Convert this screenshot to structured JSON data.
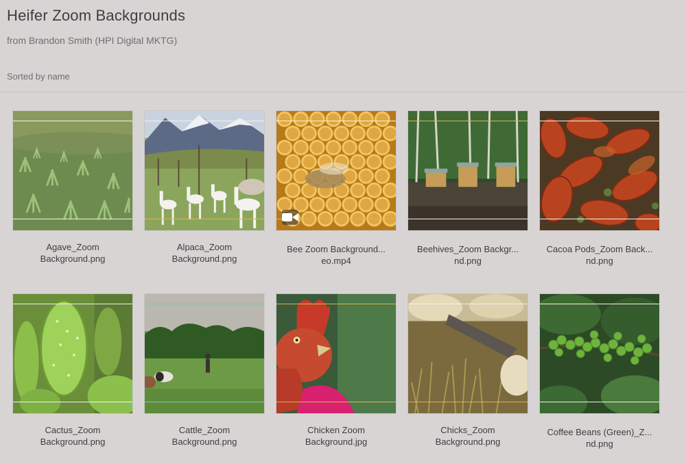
{
  "header": {
    "title": "Heifer Zoom Backgrounds",
    "subtitle": "from Brandon Smith (HPI Digital MKTG)",
    "sort_label": "Sorted by name"
  },
  "files": [
    {
      "line1": "Agave_Zoom",
      "line2": "Background.png",
      "icon": "agave-field-image"
    },
    {
      "line1": "Alpaca_Zoom",
      "line2": "Background.png",
      "icon": "alpaca-image"
    },
    {
      "line1": "Bee Zoom Background...",
      "line2": "eo.mp4",
      "icon": "honeycomb-video"
    },
    {
      "line1": "Beehives_Zoom Backgr...",
      "line2": "nd.png",
      "icon": "beehives-image"
    },
    {
      "line1": "Cacoa Pods_Zoom Back...",
      "line2": "nd.png",
      "icon": "cacao-pods-image"
    },
    {
      "line1": "Cactus_Zoom",
      "line2": "Background.png",
      "icon": "cactus-image"
    },
    {
      "line1": "Cattle_Zoom",
      "line2": "Background.png",
      "icon": "cattle-field-image"
    },
    {
      "line1": "Chicken Zoom",
      "line2": "Background.jpg",
      "icon": "chicken-image"
    },
    {
      "line1": "Chicks_Zoom",
      "line2": "Background.png",
      "icon": "chicks-image"
    },
    {
      "line1": "Coffee Beans (Green)_Z...",
      "line2": "nd.png",
      "icon": "coffee-beans-image"
    }
  ],
  "colors": {
    "background": "#d8d4d3",
    "guide_top_white": "#f4f2ee",
    "guide_gold": "#d9b64a",
    "guide_teal": "#7fc3b8"
  }
}
